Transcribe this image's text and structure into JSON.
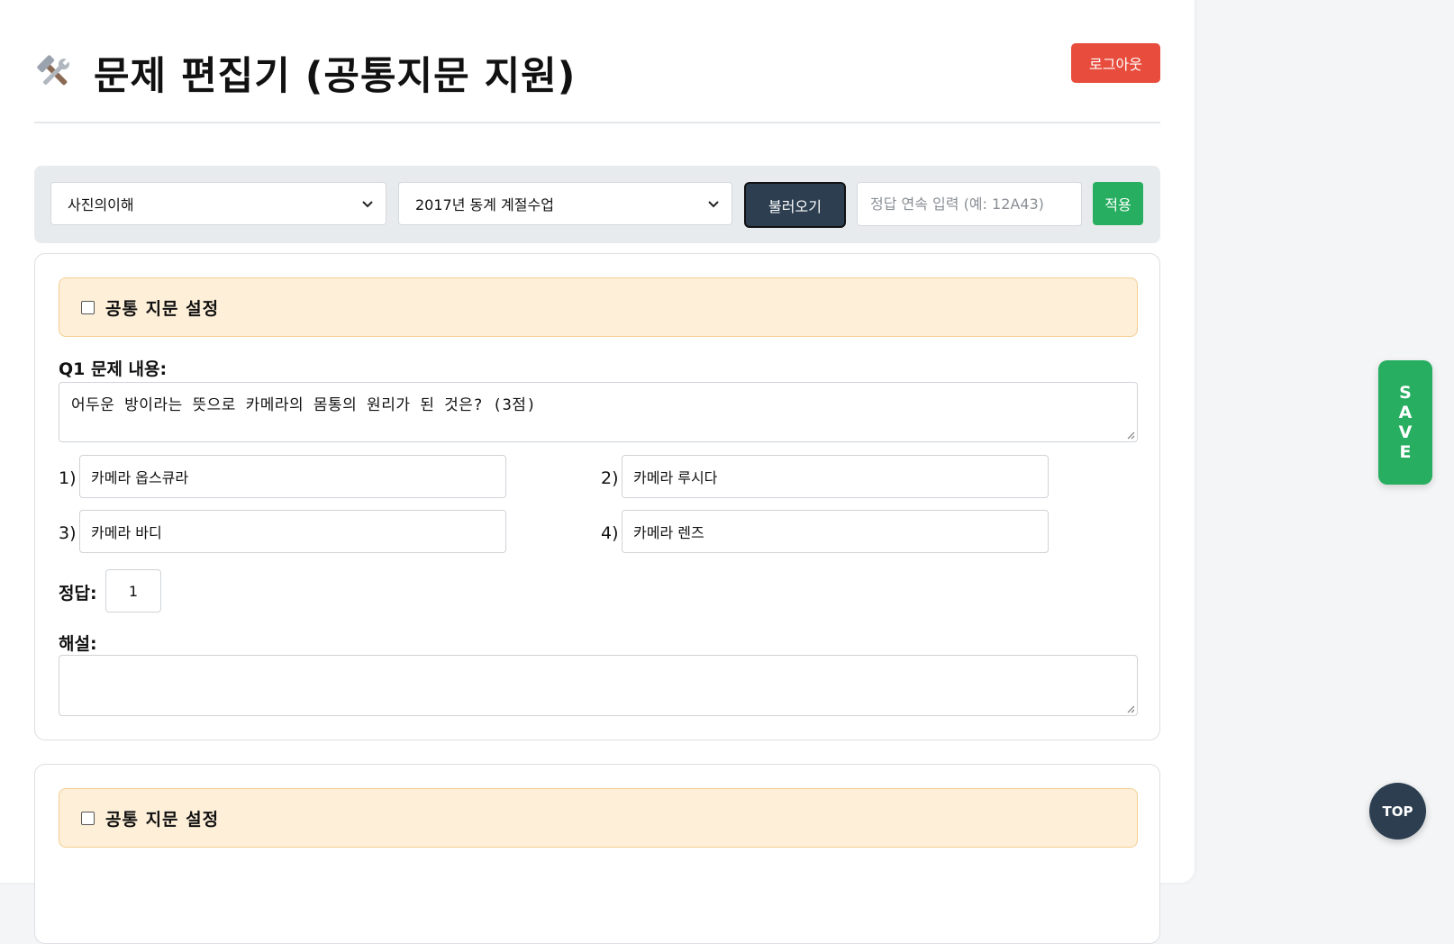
{
  "header": {
    "title": "문제 편집기 (공통지문 지원)",
    "title_icon": "hammer-wrench-icon",
    "logout_label": "로그아웃"
  },
  "toolbar": {
    "subject_select": "사진의이해",
    "exam_select": "2017년 동계 계절수업",
    "load_label": "불러오기",
    "answer_input_placeholder": "정답 연속 입력 (예: 12A43)",
    "apply_label": "적용"
  },
  "questions": [
    {
      "common_passage_label": "공통 지문 설정",
      "common_passage_checked": false,
      "question_label": "Q1 문제 내용:",
      "question_text": "어두운 방이라는 뜻으로 카메라의 몸통의 원리가 된 것은? (3점)",
      "options": [
        {
          "num": "1)",
          "text": "카메라 옵스큐라"
        },
        {
          "num": "2)",
          "text": "카메라 루시다"
        },
        {
          "num": "3)",
          "text": "카메라 바디"
        },
        {
          "num": "4)",
          "text": "카메라 렌즈"
        }
      ],
      "answer_label": "정답:",
      "answer_value": "1",
      "explanation_label": "해설:",
      "explanation_text": ""
    },
    {
      "common_passage_label": "공통 지문 설정",
      "common_passage_checked": false
    }
  ],
  "floating": {
    "save_letters": [
      "S",
      "A",
      "V",
      "E"
    ],
    "top_label": "TOP"
  },
  "colors": {
    "danger": "#e74c3c",
    "success": "#27ae60",
    "dark": "#2c3e50",
    "passage_bg": "#fdefd8"
  }
}
